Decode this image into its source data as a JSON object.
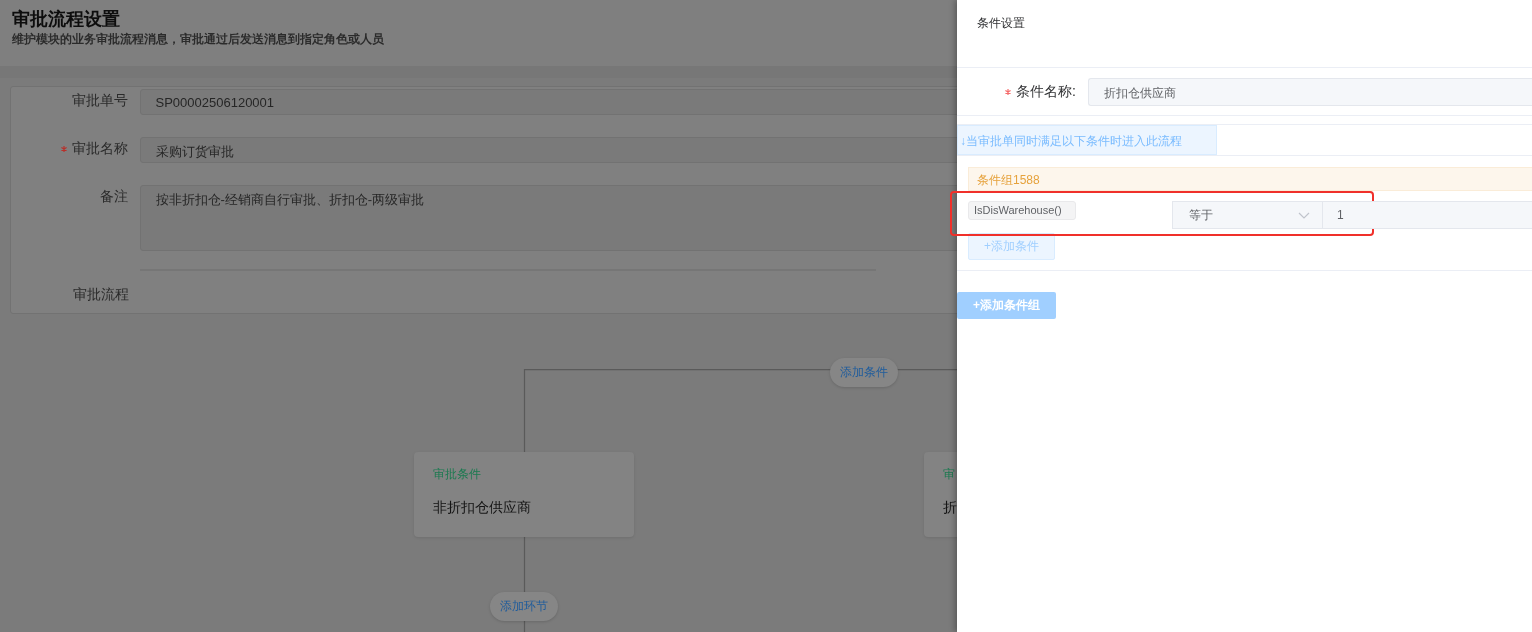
{
  "page": {
    "title": "审批流程设置",
    "subtitle": "维护模块的业务审批流程消息，审批通过后发送消息到指定角色或人员"
  },
  "form": {
    "fields": [
      {
        "label": "审批单号",
        "required": false,
        "kind": "input",
        "value": "SP00002506120001"
      },
      {
        "label": "审批名称",
        "required": true,
        "kind": "input",
        "value": "采购订货审批"
      },
      {
        "label": "备注",
        "required": false,
        "kind": "textarea",
        "value": "按非折扣仓-经销商自行审批、折扣仓-两级审批"
      },
      {
        "label": "审批流程",
        "required": false,
        "kind": "flow"
      }
    ]
  },
  "flow": {
    "add_condition_button": "添加条件",
    "branches": [
      {
        "title": "审批条件",
        "name": "非折扣仓供应商"
      },
      {
        "title": "审",
        "name": "折"
      }
    ],
    "add_step_button": "添加环节"
  },
  "drawer": {
    "title": "条件设置",
    "condition_name": {
      "label": "条件名称:",
      "required": true,
      "value": "折扣仓供应商"
    },
    "tip": "↓当审批单同时满足以下条件时进入此流程",
    "groups": [
      {
        "title": "条件组1588",
        "conditions": [
          {
            "field": "IsDisWarehouse()",
            "operator": "等于",
            "value": "1"
          }
        ],
        "add_condition_button": "+添加条件"
      }
    ],
    "add_group_button": "+添加条件组"
  }
}
